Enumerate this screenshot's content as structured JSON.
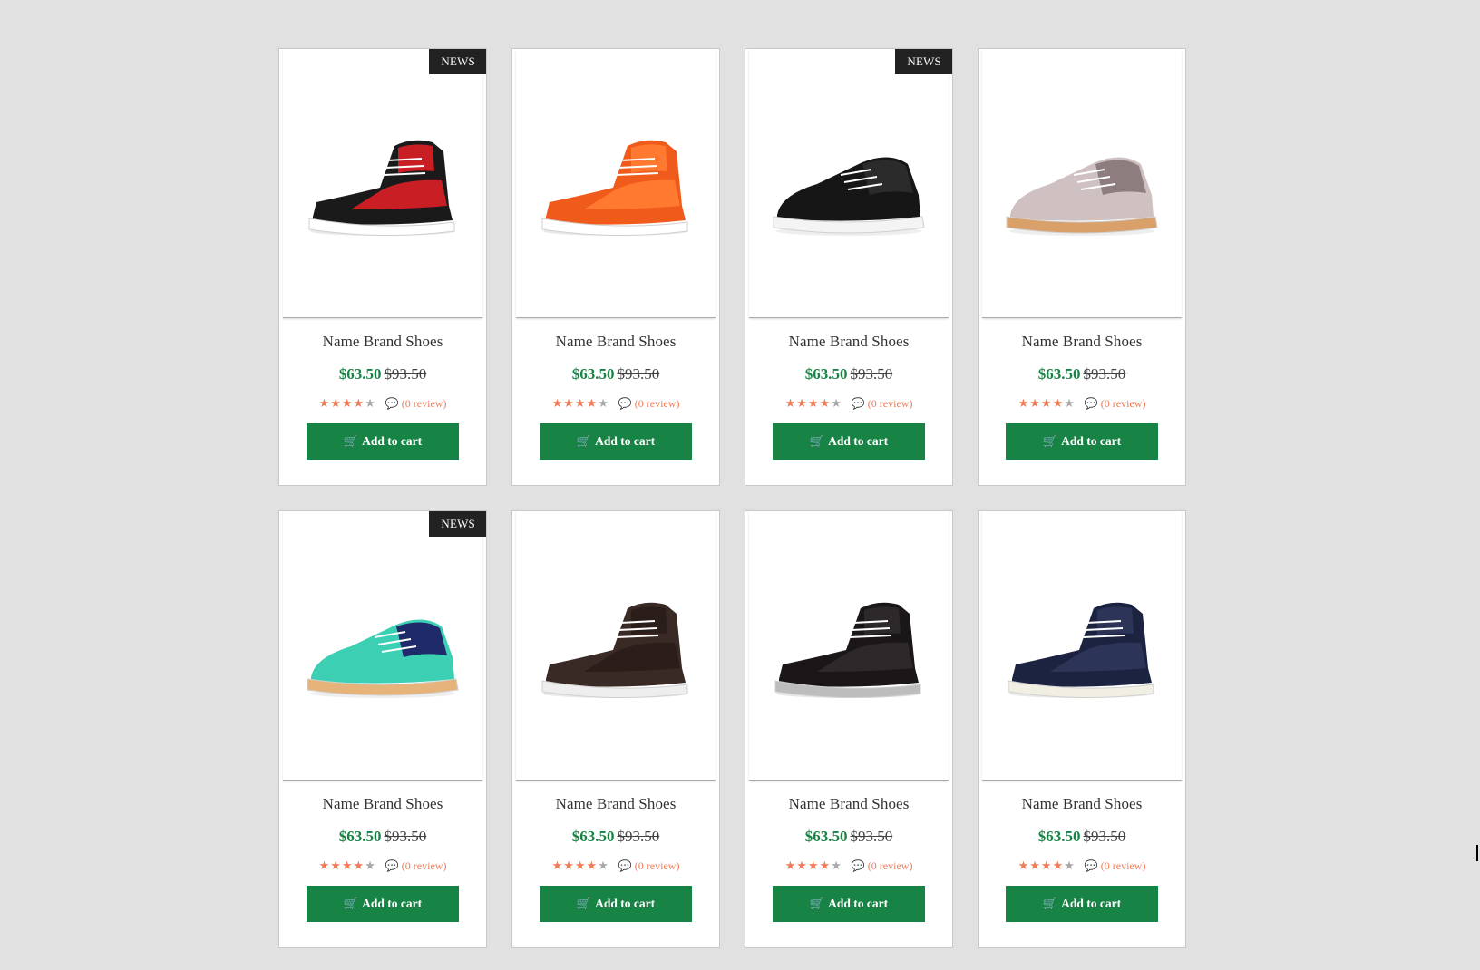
{
  "products": [
    {
      "badge": "NEWS",
      "title": "Name Brand Shoes",
      "price_new": "$63.50",
      "price_old": "$93.50",
      "rating": 4,
      "review_text": "(0 review)",
      "cart_label": "Add to cart",
      "shoe": {
        "kind": "high",
        "c1": "#1a1a1a",
        "c2": "#c81e24",
        "sole": "#ffffff"
      }
    },
    {
      "badge": "",
      "title": "Name Brand Shoes",
      "price_new": "$63.50",
      "price_old": "$93.50",
      "rating": 4,
      "review_text": "(0 review)",
      "cart_label": "Add to cart",
      "shoe": {
        "kind": "high",
        "c1": "#f05a1a",
        "c2": "#ff7a30",
        "sole": "#ffffff"
      }
    },
    {
      "badge": "NEWS",
      "title": "Name Brand Shoes",
      "price_new": "$63.50",
      "price_old": "$93.50",
      "rating": 4,
      "review_text": "(0 review)",
      "cart_label": "Add to cart",
      "shoe": {
        "kind": "low",
        "c1": "#161616",
        "c2": "#2b2b2b",
        "sole": "#f4f4f4"
      }
    },
    {
      "badge": "",
      "title": "Name Brand Shoes",
      "price_new": "$63.50",
      "price_old": "$93.50",
      "rating": 4,
      "review_text": "(0 review)",
      "cart_label": "Add to cart",
      "shoe": {
        "kind": "low",
        "c1": "#cfc1c1",
        "c2": "#8d7d7f",
        "sole": "#d9a06a"
      }
    },
    {
      "badge": "NEWS",
      "title": "Name Brand Shoes",
      "price_new": "$63.50",
      "price_old": "$93.50",
      "rating": 4,
      "review_text": "(0 review)",
      "cart_label": "Add to cart",
      "shoe": {
        "kind": "low",
        "c1": "#3ccfb4",
        "c2": "#1f2a6a",
        "sole": "#e6b47a"
      }
    },
    {
      "badge": "",
      "title": "Name Brand Shoes",
      "price_new": "$63.50",
      "price_old": "$93.50",
      "rating": 4,
      "review_text": "(0 review)",
      "cart_label": "Add to cart",
      "shoe": {
        "kind": "high",
        "c1": "#3a2a26",
        "c2": "#2a1d1a",
        "sole": "#eeeeee"
      }
    },
    {
      "badge": "",
      "title": "Name Brand Shoes",
      "price_new": "$63.50",
      "price_old": "$93.50",
      "rating": 4,
      "review_text": "(0 review)",
      "cart_label": "Add to cart",
      "shoe": {
        "kind": "high",
        "c1": "#1b1718",
        "c2": "#2d2829",
        "sole": "#bdbdbd"
      }
    },
    {
      "badge": "",
      "title": "Name Brand Shoes",
      "price_new": "$63.50",
      "price_old": "$93.50",
      "rating": 4,
      "review_text": "(0 review)",
      "cart_label": "Add to cart",
      "shoe": {
        "kind": "high",
        "c1": "#1c2340",
        "c2": "#2c3558",
        "sole": "#f1eee4"
      }
    }
  ],
  "icons": {
    "cart": "shopping-cart-icon",
    "review": "comments-icon",
    "star": "star-icon"
  },
  "colors": {
    "accent": "#178344",
    "star": "#f07b56",
    "badge_bg": "#222222",
    "background": "#e1e1e1"
  }
}
